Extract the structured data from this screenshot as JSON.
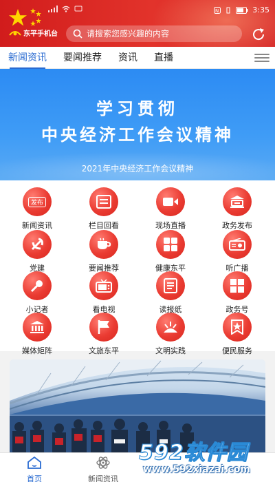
{
  "status": {
    "time": "3:35"
  },
  "header": {
    "logo_text": "东平手机台",
    "search_placeholder": "请搜索您感兴趣的内容"
  },
  "tabs": [
    {
      "label": "新闻资讯",
      "active": true
    },
    {
      "label": "要闻推荐"
    },
    {
      "label": "资讯"
    },
    {
      "label": "直播"
    }
  ],
  "banner": {
    "line1": "学习贯彻",
    "line2": "中央经济工作会议精神",
    "caption": "2021年中央经济工作会议精神"
  },
  "grid": [
    {
      "label": "新闻资讯",
      "icon": "publish-tag-icon",
      "tag": "发布"
    },
    {
      "label": "栏目回看",
      "icon": "column-list-icon"
    },
    {
      "label": "现场直播",
      "icon": "video-camera-icon"
    },
    {
      "label": "政务发布",
      "icon": "government-building-icon"
    },
    {
      "label": "党建",
      "icon": "party-emblem-icon"
    },
    {
      "label": "要闻推荐",
      "icon": "cup-icon"
    },
    {
      "label": "健康东平",
      "icon": "health-grid-icon"
    },
    {
      "label": "听广播",
      "icon": "radio-icon"
    },
    {
      "label": "小记者",
      "icon": "microphone-icon"
    },
    {
      "label": "看电视",
      "icon": "tv-icon"
    },
    {
      "label": "读报纸",
      "icon": "newspaper-icon"
    },
    {
      "label": "政务号",
      "icon": "apps-grid-icon"
    },
    {
      "label": "媒体矩阵",
      "icon": "institution-icon"
    },
    {
      "label": "文旅东平",
      "icon": "flag-icon"
    },
    {
      "label": "文明实践",
      "icon": "sunburst-icon"
    },
    {
      "label": "便民服务",
      "icon": "star-badge-icon"
    }
  ],
  "bottom_nav": [
    {
      "label": "首页",
      "active": true,
      "icon": "home-icon"
    },
    {
      "label": "新闻资讯",
      "icon": "atom-icon"
    }
  ],
  "watermark": {
    "big": "592软件园",
    "url": "www.592xiazai.com"
  },
  "colors": {
    "header_red": "#d11c1c",
    "accent_blue": "#2a6bd1",
    "icon_red": "#ea3b32",
    "banner_blue": "#2c8bf3"
  }
}
